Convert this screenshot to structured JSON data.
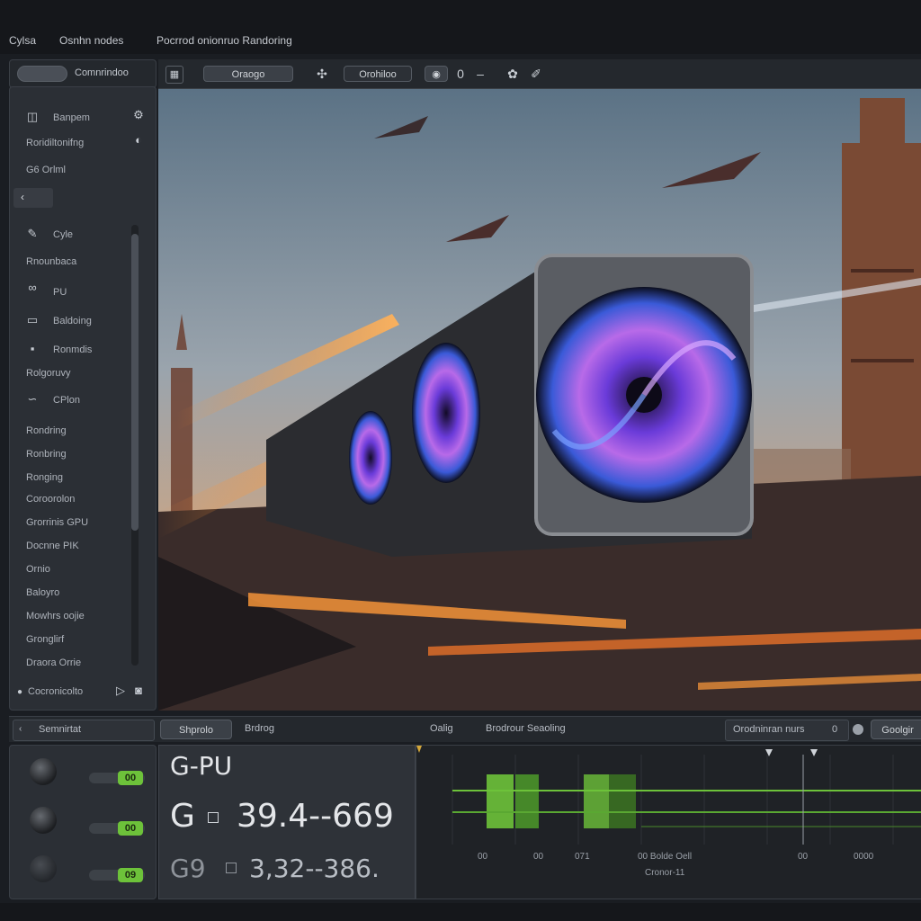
{
  "titlebar": {
    "app": "Cylsa",
    "menu1": "Osnhn nodes",
    "menu2": "Pocrrod onionruo Randoring"
  },
  "left_toolbar": {
    "tab1": "",
    "tab2": "Comnrindoo"
  },
  "left_panel": {
    "items": [
      {
        "label": "Banpem"
      },
      {
        "label": "Roridiltonifng"
      },
      {
        "label": "G6 Orlml"
      },
      {
        "label": "Cyle"
      },
      {
        "label": "Rnounbaca"
      },
      {
        "label": "PU"
      },
      {
        "label": "Baldoing"
      },
      {
        "label": "Ronmdis"
      },
      {
        "label": "Rolgoruvy"
      },
      {
        "label": "CPlon"
      },
      {
        "label": "Rondring"
      },
      {
        "label": "Ronbring"
      },
      {
        "label": "Ronging"
      },
      {
        "label": "Coroorolon"
      },
      {
        "label": "Grorrinis GPU"
      },
      {
        "label": "Docnne PIK"
      },
      {
        "label": "Ornio"
      },
      {
        "label": "Baloyro"
      },
      {
        "label": "Mowhrs oojie"
      },
      {
        "label": "Gronglirf"
      },
      {
        "label": "Draora Orrie"
      }
    ],
    "footer": "Cocronicolto"
  },
  "view_toolbar": {
    "mode": "Oraogo",
    "status": "Orohiloo",
    "zoom": "0"
  },
  "bottom_strip": {
    "left": "Semnirtat",
    "tab1": "Shprolo",
    "tab2": "Brdrog",
    "center1": "Oalig",
    "center2": "Brodrour Seaoling",
    "right1": "Orodninran nurs",
    "right1_value": "0",
    "right2": "Goolgir"
  },
  "materials": [
    {
      "value": "00"
    },
    {
      "value": "00"
    },
    {
      "value": "09"
    }
  ],
  "gpu": {
    "title": "G-PU",
    "row1_label": "G",
    "row1_value": "39.4--669",
    "row2_label": "G9",
    "row2_value": "3,32--386."
  },
  "timeline": {
    "ticks": [
      "00",
      "00",
      "071",
      "00 Bolde Oell",
      "00",
      "0000"
    ],
    "sublabel": "Cronor-11"
  },
  "colors": {
    "accent_green": "#6dc23a",
    "panel": "#2b2f35",
    "background": "#1a1d22"
  }
}
